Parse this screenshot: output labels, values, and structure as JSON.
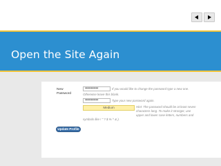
{
  "navigation": {
    "prev_icon": "triangle-left-icon",
    "next_icon": "triangle-right-icon"
  },
  "slide": {
    "title": "Open the Site Again"
  },
  "form": {
    "new_password_label_line1": "New",
    "new_password_label_line2": "Password",
    "password_value_1": "•••••••••••",
    "password_value_2": "•••••••••••",
    "hint_change_part1": "If you would like to change the password type a new one.",
    "hint_change_part2": "Otherwise leave this blank.",
    "hint_again": "Type your new password again.",
    "strength_label": "Medium",
    "hint_strength_line1": "Hint: The password should be at least seven",
    "hint_strength_line2": "characters long. To make it stronger, use",
    "hint_strength_line3": "upper and lower case letters, numbers and",
    "hint_strength_line4": "symbols like ! \" ? $ % ^ & ).",
    "update_button_label": "Update Profile"
  },
  "colors": {
    "title_band": "#2c8fd0",
    "accent_stripe": "#f2c43a",
    "strength_bg": "#fff0a8",
    "button_bg": "#3a6fa8"
  }
}
